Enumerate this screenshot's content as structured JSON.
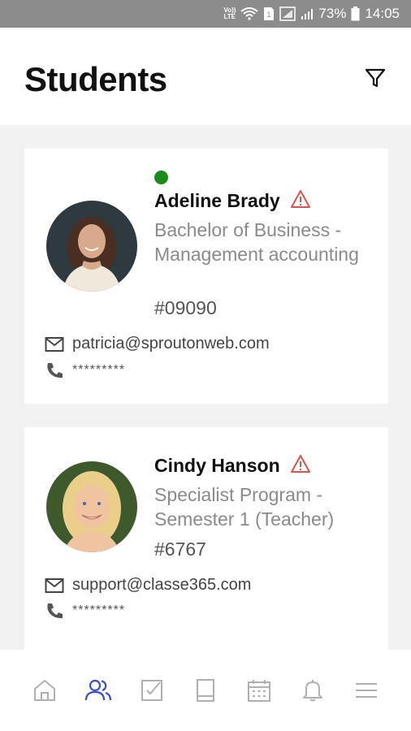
{
  "status_bar": {
    "volte_top": "Vo))",
    "volte_bottom": "LTE",
    "sim": "1",
    "battery": "73%",
    "time": "14:05"
  },
  "header": {
    "title": "Students",
    "filter_icon": "filter-icon"
  },
  "students": [
    {
      "name": "Adeline Brady",
      "online": true,
      "warning": true,
      "program": "Bachelor of Business - Management accounting",
      "code": "#09090",
      "email": "patricia@sproutonweb.com",
      "phone": "*********"
    },
    {
      "name": "Cindy Hanson",
      "online": false,
      "warning": true,
      "program": "Specialist Program - Semester 1 (Teacher)",
      "code": "#6767",
      "email": "support@classe365.com",
      "phone": "*********"
    }
  ],
  "bottom_nav": {
    "items": [
      "home-icon",
      "students-icon",
      "tasks-icon",
      "book-icon",
      "calendar-icon",
      "bell-icon",
      "menu-icon"
    ],
    "active": "students-icon"
  },
  "colors": {
    "accent": "#3b4fc4",
    "online": "#1a8a1a",
    "warning": "#d9534f",
    "status_bar": "#8c8c8c"
  }
}
